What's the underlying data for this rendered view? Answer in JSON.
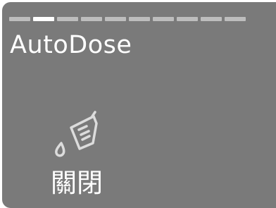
{
  "app": {
    "title": "AutoDose"
  },
  "pager": {
    "total_pages": 10,
    "active_index": 1
  },
  "status": {
    "label": "關閉"
  },
  "icon": {
    "name": "detergent-dispenser-icon"
  },
  "colors": {
    "panel_background": "#7a7a7a",
    "text": "#ffffff",
    "icon": "#dcdcdc",
    "pager_inactive": "#bdbdbd",
    "pager_active": "#ffffff"
  }
}
